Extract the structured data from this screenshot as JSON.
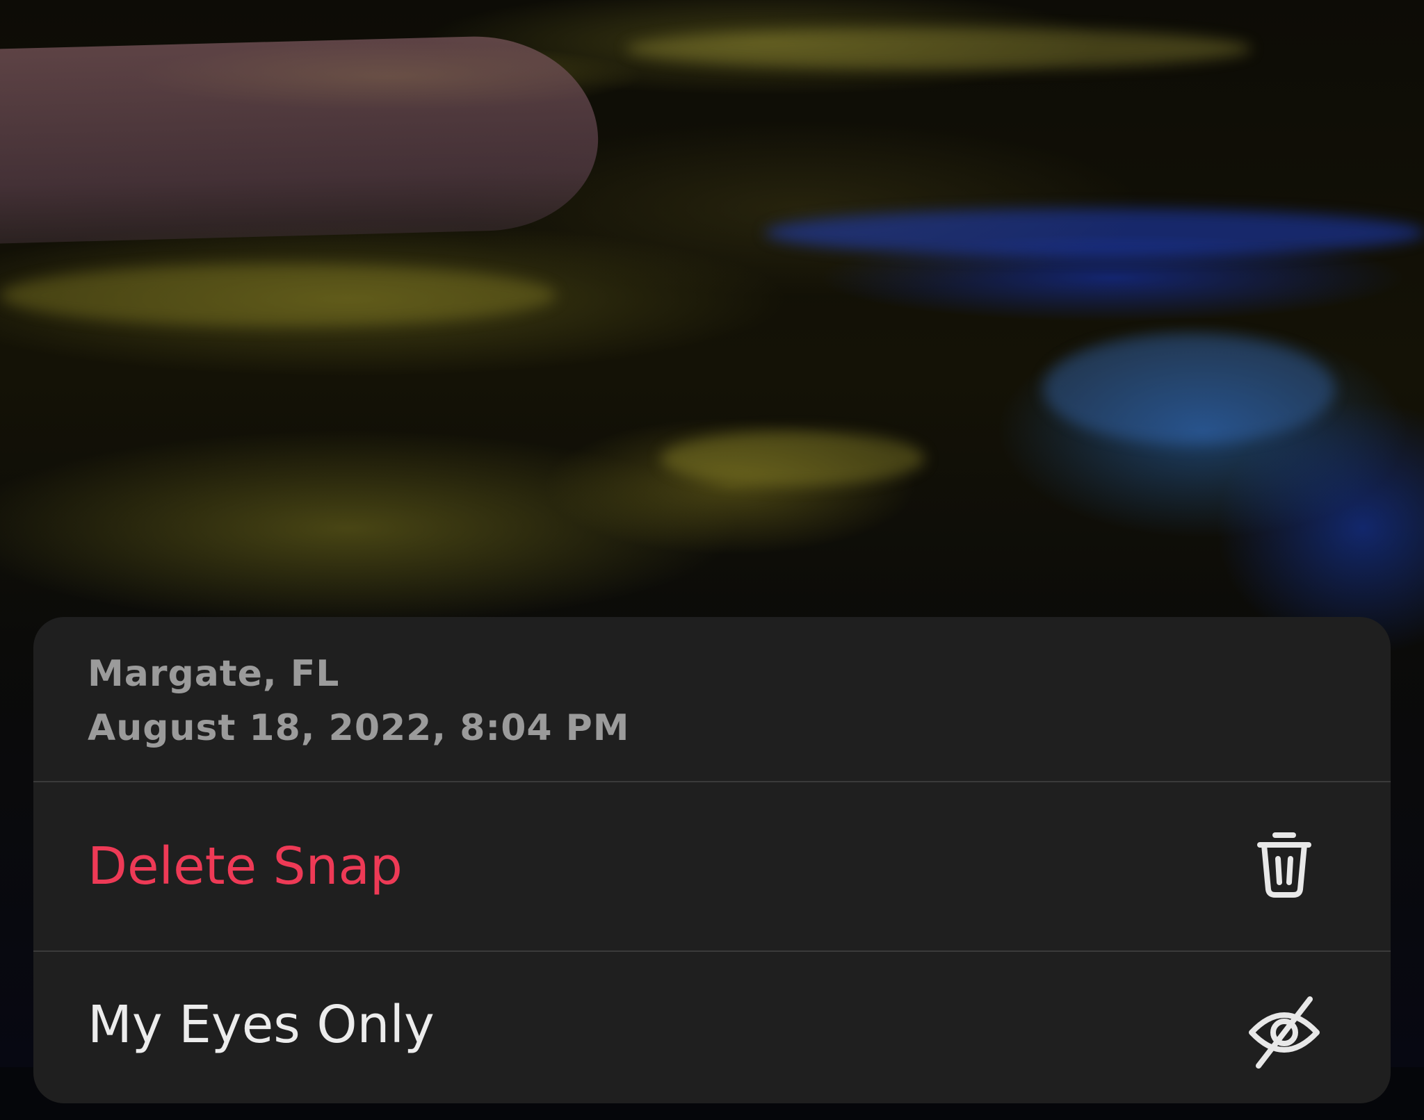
{
  "background": {
    "description_icon": "photo-preview"
  },
  "snap_info": {
    "location": "Margate, FL",
    "datetime": "August 18, 2022, 8:04 PM"
  },
  "actions": [
    {
      "label": "Delete Snap",
      "icon": "trash-icon",
      "color": "#ee3a56"
    },
    {
      "label": "My Eyes Only",
      "icon": "eye-slash-icon",
      "color": "#ececec"
    }
  ],
  "colors": {
    "sheet_background": "#1f1f1f",
    "meta_text": "#9b9b9b",
    "destructive": "#ee3a56"
  }
}
